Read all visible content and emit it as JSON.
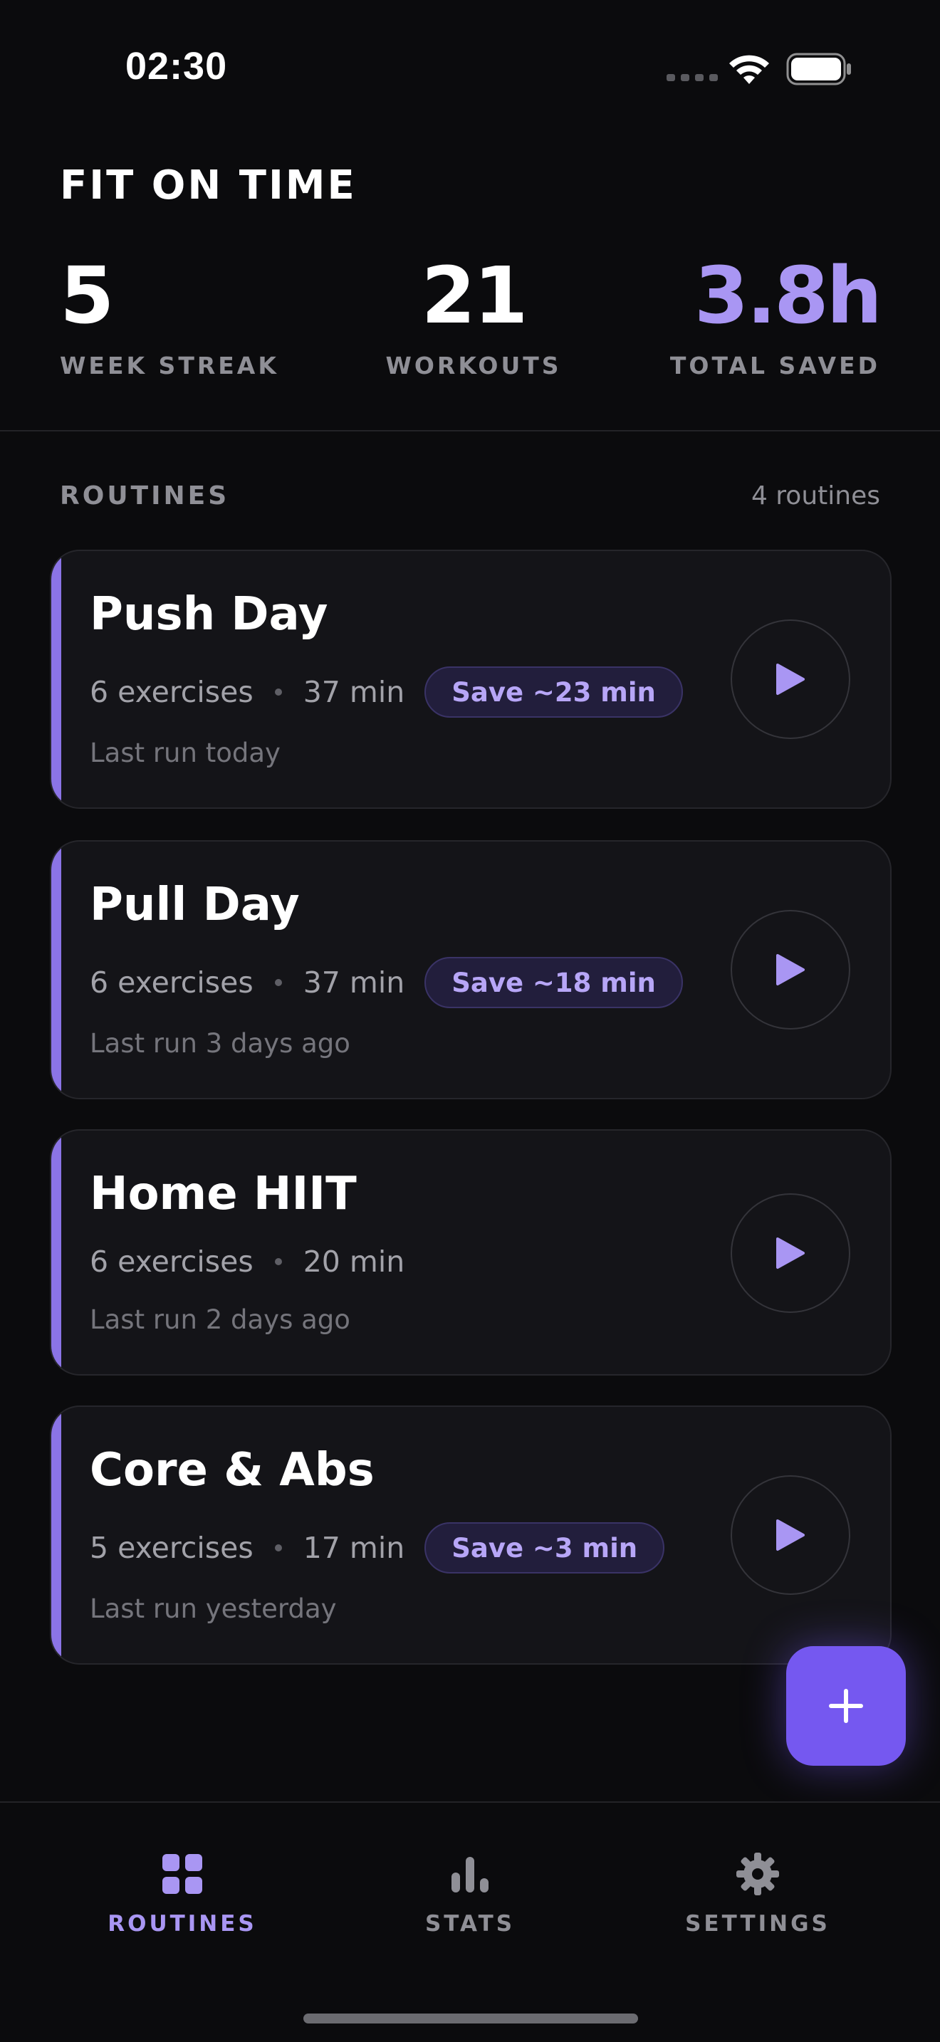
{
  "status": {
    "time": "02:30"
  },
  "header": {
    "title": "FIT ON TIME",
    "stats": [
      {
        "value": "5",
        "label": "WEEK STREAK"
      },
      {
        "value": "21",
        "label": "WORKOUTS"
      },
      {
        "value": "3.8h",
        "label": "TOTAL SAVED"
      }
    ]
  },
  "routines": {
    "title": "ROUTINES",
    "count": "4 routines",
    "items": [
      {
        "name": "Push Day",
        "exercises": "6 exercises",
        "duration": "37 min",
        "save": "Save ~23 min",
        "last_run": "Last run today"
      },
      {
        "name": "Pull Day",
        "exercises": "6 exercises",
        "duration": "37 min",
        "save": "Save ~18 min",
        "last_run": "Last run 3 days ago"
      },
      {
        "name": "Home HIIT",
        "exercises": "6 exercises",
        "duration": "20 min",
        "save": "",
        "last_run": "Last run 2 days ago"
      },
      {
        "name": "Core & Abs",
        "exercises": "5 exercises",
        "duration": "17 min",
        "save": "Save ~3 min",
        "last_run": "Last run yesterday"
      }
    ]
  },
  "tabs": [
    {
      "label": "ROUTINES",
      "icon": "grid-icon",
      "active": true
    },
    {
      "label": "STATS",
      "icon": "bar-chart-icon",
      "active": false
    },
    {
      "label": "SETTINGS",
      "icon": "gear-icon",
      "active": false
    }
  ],
  "colors": {
    "accent": "#8b74e6",
    "accent_text": "#a996f3",
    "fab": "#7558f0",
    "background": "#0b0b0d",
    "card": "#141418"
  }
}
